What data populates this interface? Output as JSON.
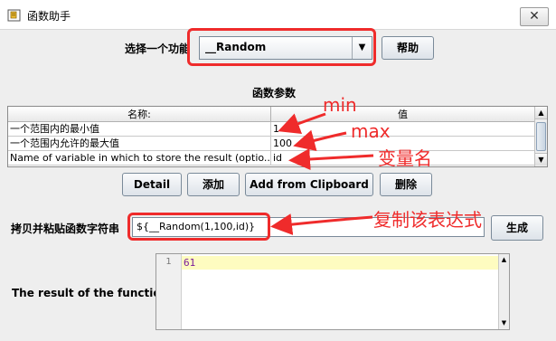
{
  "window": {
    "title": "函数助手"
  },
  "function_row": {
    "label": "选择一个功能",
    "selected": "__Random",
    "help_label": "帮助"
  },
  "params": {
    "title": "函数参数",
    "columns": [
      "名称:",
      "值"
    ],
    "rows": [
      {
        "name": "一个范围内的最小值",
        "value": "1"
      },
      {
        "name": "一个范围内允许的最大值",
        "value": "100"
      },
      {
        "name": "Name of variable in which to store the result (optio...",
        "value": "id"
      }
    ]
  },
  "buttons": {
    "detail": "Detail",
    "add": "添加",
    "clipboard": "Add from Clipboard",
    "delete": "删除"
  },
  "copy_row": {
    "label": "拷贝并粘贴函数字符串",
    "value": "${__Random(1,100,id)}",
    "generate_label": "生成"
  },
  "result": {
    "label": "The result of the function is",
    "line_number": "1",
    "value": "61"
  },
  "annotations": {
    "min": "min",
    "max": "max",
    "varname": "变量名",
    "copy_expr": "复制该表达式"
  },
  "colors": {
    "annotation": "#ef2b2b",
    "result_highlight": "#fefcc0"
  }
}
